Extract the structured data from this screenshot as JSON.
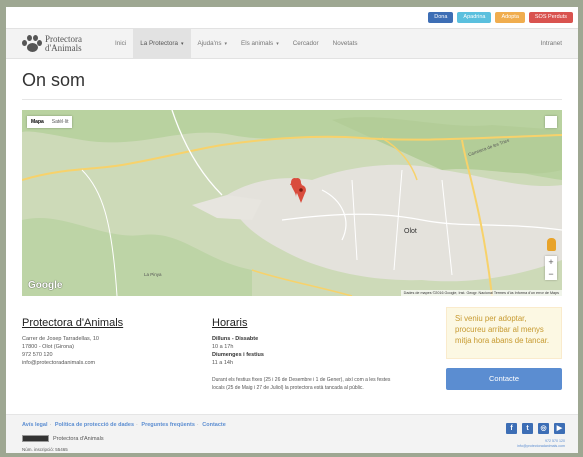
{
  "top_buttons": [
    {
      "label": "Dona",
      "color": "#3d6eb5"
    },
    {
      "label": "Apadrina",
      "color": "#5bc0de"
    },
    {
      "label": "Adopta",
      "color": "#f0ad4e"
    },
    {
      "label": "SOS Perduts",
      "color": "#d9534f"
    }
  ],
  "brand": {
    "line1": "Protectora",
    "line2": "d'Animals"
  },
  "nav": {
    "items": [
      {
        "label": "Inici"
      },
      {
        "label": "La Protectora",
        "caret": "▾"
      },
      {
        "label": "Ajuda'ns",
        "caret": "▾"
      },
      {
        "label": "Els animals",
        "caret": "▾"
      },
      {
        "label": "Cercador"
      },
      {
        "label": "Novetats"
      }
    ],
    "right": "Intranet"
  },
  "page_title": "On som",
  "map": {
    "tab_map": "Mapa",
    "tab_sat": "Satèl·lit",
    "zoom_in": "+",
    "zoom_out": "−",
    "logo": "Google",
    "attribution": "Dades de mapes ©2016 Google, Inst. Geogr. Nacional   Termes d'ús   Informa d'un error de Maps",
    "labels": {
      "olot": "Olot",
      "la_pinya": "La Pinya",
      "ctra": "Carretera de les Tries"
    },
    "accent": "#d94c3d"
  },
  "address": {
    "title": "Protectora d'Animals",
    "lines": [
      "Carrer de Josep Tarradellas, 10",
      "17800 - Olot (Girona)",
      "972 570 120",
      "info@protectoradanimals.com"
    ]
  },
  "hours": {
    "title": "Horaris",
    "weekday_label": "Dilluns - Dissabte",
    "weekday_time": "10 a 17h",
    "holiday_label": "Diumenges i festius",
    "holiday_time": "11 a 14h",
    "note": "Durant els festius fixes (25 i 26 de Desembre i 1 de Gener), així com a les festes locals (25 de Maig i 27 de Juliol) la protectora està tancada al públic."
  },
  "warning": "Si veniu per adoptar, procureu arribar al menys mitja hora abans de tancar.",
  "contact_button": "Contacte",
  "footer": {
    "links": [
      "Avís legal",
      "Política de protecció de dades",
      "Preguntes freqüents",
      "Contacte"
    ],
    "license_text": "Protectora d'Animals",
    "registration": "Núm. inscripció: 55465",
    "phone": "972 570 120",
    "email": "info@protectoradanimals.com"
  }
}
